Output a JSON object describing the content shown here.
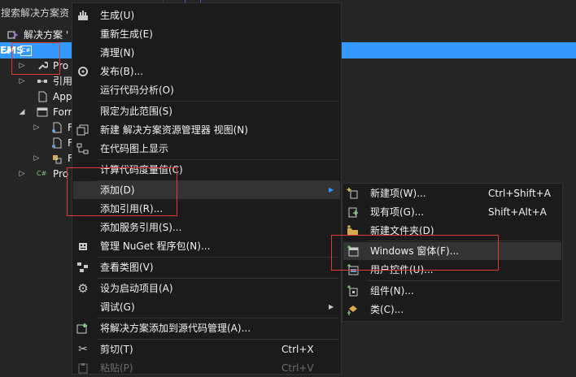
{
  "explorer": {
    "search_placeholder": "搜索解决方案资",
    "solution_label": "解决方案 '",
    "project_label": "EMS",
    "project_badge": "C#",
    "tree": [
      {
        "label": "Pro",
        "icon": "wrench-icon"
      },
      {
        "label": "引用",
        "icon": "references-icon"
      },
      {
        "label": "App",
        "icon": "config-file-icon"
      },
      {
        "label": "Forr",
        "icon": "form-icon"
      },
      {
        "label": "F",
        "icon": "form-icon"
      },
      {
        "label": "F",
        "icon": "form-icon"
      },
      {
        "label": "F",
        "icon": "form-icon"
      },
      {
        "label": "Pro",
        "icon": "csharp-file-icon"
      }
    ]
  },
  "context_menu": {
    "items": [
      {
        "label": "生成(U)",
        "icon": "build-icon"
      },
      {
        "label": "重新生成(E)",
        "icon": ""
      },
      {
        "label": "清理(N)",
        "icon": ""
      },
      {
        "label": "发布(B)...",
        "icon": "publish-icon"
      },
      {
        "label": "运行代码分析(O)",
        "icon": ""
      },
      {
        "label": "限定为此范围(S)",
        "icon": ""
      },
      {
        "label": "新建 解决方案资源管理器 视图(N)",
        "icon": "new-view-icon"
      },
      {
        "label": "在代码图上显示",
        "icon": "code-map-icon"
      },
      {
        "label": "计算代码度量值(C)",
        "icon": ""
      },
      {
        "label": "添加(D)",
        "icon": ""
      },
      {
        "label": "添加引用(R)...",
        "icon": ""
      },
      {
        "label": "添加服务引用(S)...",
        "icon": ""
      },
      {
        "label": "管理 NuGet 程序包(N)...",
        "icon": "nuget-icon"
      },
      {
        "label": "查看类图(V)",
        "icon": "class-diagram-icon"
      },
      {
        "label": "设为启动项目(A)",
        "icon": "gear-icon"
      },
      {
        "label": "调试(G)",
        "icon": ""
      },
      {
        "label": "将解决方案添加到源代码管理(A)...",
        "icon": "source-control-icon"
      },
      {
        "label": "剪切(T)",
        "icon": "cut-icon",
        "shortcut": "Ctrl+X"
      },
      {
        "label": "粘贴(P)",
        "icon": "paste-icon",
        "shortcut": "Ctrl+V"
      }
    ]
  },
  "add_submenu": {
    "items": [
      {
        "label": "新建项(W)...",
        "shortcut": "Ctrl+Shift+A",
        "icon": "new-item-icon"
      },
      {
        "label": "现有项(G)...",
        "shortcut": "Shift+Alt+A",
        "icon": "existing-item-icon"
      },
      {
        "label": "新建文件夹(D)",
        "shortcut": "",
        "icon": "new-folder-icon"
      },
      {
        "label": "Windows 窗体(F)...",
        "shortcut": "",
        "icon": "windows-form-icon"
      },
      {
        "label": "用户控件(U)...",
        "shortcut": "",
        "icon": "user-control-icon"
      },
      {
        "label": "组件(N)...",
        "shortcut": "",
        "icon": "component-icon"
      },
      {
        "label": "类(C)...",
        "shortcut": "",
        "icon": "class-icon"
      }
    ]
  },
  "colors": {
    "selection": "#3399ff",
    "annotation": "#e03c31",
    "menu_bg": "#1b1b1c"
  }
}
